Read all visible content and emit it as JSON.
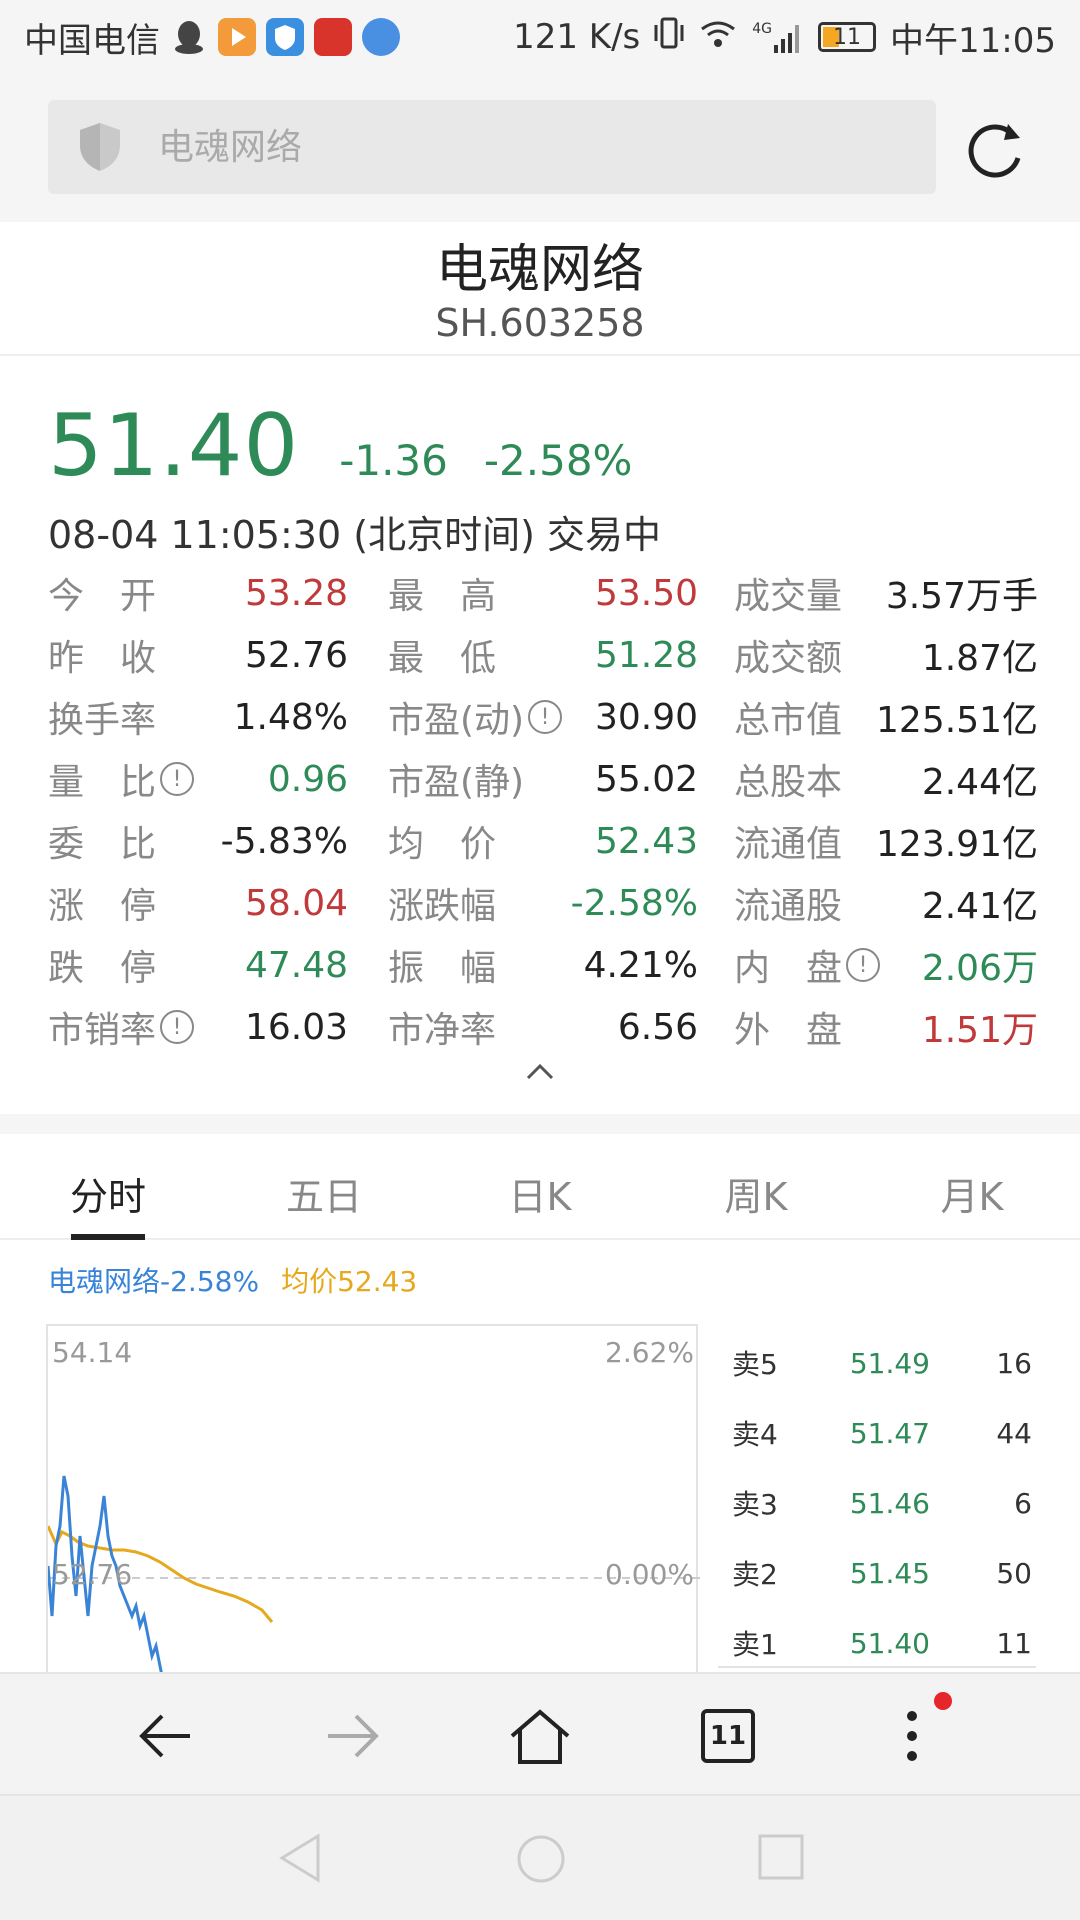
{
  "status_bar": {
    "carrier": "中国电信",
    "net_speed": "121 K/s",
    "network": "4G",
    "battery": "11",
    "time": "中午11:05"
  },
  "search": {
    "placeholder": "电魂网络"
  },
  "stock": {
    "name": "电魂网络",
    "code": "SH.603258",
    "price": "51.40",
    "change": "-1.36",
    "change_pct": "-2.58%",
    "time_status": "08-04 11:05:30 (北京时间) 交易中"
  },
  "stats": [
    [
      {
        "label": "今　开",
        "value": "53.28",
        "color": "red"
      },
      {
        "label": "最　高",
        "value": "53.50",
        "color": "red"
      },
      {
        "label": "成交量",
        "value": "3.57万手",
        "color": ""
      }
    ],
    [
      {
        "label": "昨　收",
        "value": "52.76",
        "color": ""
      },
      {
        "label": "最　低",
        "value": "51.28",
        "color": "green"
      },
      {
        "label": "成交额",
        "value": "1.87亿",
        "color": ""
      }
    ],
    [
      {
        "label": "换手率",
        "value": "1.48%",
        "color": ""
      },
      {
        "label": "市盈(动)",
        "value": "30.90",
        "color": "",
        "info": true
      },
      {
        "label": "总市值",
        "value": "125.51亿",
        "color": ""
      }
    ],
    [
      {
        "label": "量　比",
        "value": "0.96",
        "color": "green",
        "info": true
      },
      {
        "label": "市盈(静)",
        "value": "55.02",
        "color": ""
      },
      {
        "label": "总股本",
        "value": "2.44亿",
        "color": ""
      }
    ],
    [
      {
        "label": "委　比",
        "value": "-5.83%",
        "color": ""
      },
      {
        "label": "均　价",
        "value": "52.43",
        "color": "green"
      },
      {
        "label": "流通值",
        "value": "123.91亿",
        "color": ""
      }
    ],
    [
      {
        "label": "涨　停",
        "value": "58.04",
        "color": "red"
      },
      {
        "label": "涨跌幅",
        "value": "-2.58%",
        "color": "green"
      },
      {
        "label": "流通股",
        "value": "2.41亿",
        "color": ""
      }
    ],
    [
      {
        "label": "跌　停",
        "value": "47.48",
        "color": "green"
      },
      {
        "label": "振　幅",
        "value": "4.21%",
        "color": ""
      },
      {
        "label": "内　盘",
        "value": "2.06万",
        "color": "green",
        "info": true
      }
    ],
    [
      {
        "label": "市销率",
        "value": "16.03",
        "color": "",
        "info": true
      },
      {
        "label": "市净率",
        "value": "6.56",
        "color": ""
      },
      {
        "label": "外　盘",
        "value": "1.51万",
        "color": "red"
      }
    ]
  ],
  "tabs": [
    "分时",
    "五日",
    "日K",
    "周K",
    "月K"
  ],
  "chart_legend": {
    "price": "电魂网络-2.58%",
    "avg": "均价52.43"
  },
  "chart_axis": {
    "top_price": "54.14",
    "top_pct": "2.62%",
    "mid_price": "52.76",
    "mid_pct": "0.00%"
  },
  "order_book": [
    {
      "label": "卖5",
      "price": "51.49",
      "vol": "16"
    },
    {
      "label": "卖4",
      "price": "51.47",
      "vol": "44"
    },
    {
      "label": "卖3",
      "price": "51.46",
      "vol": "6"
    },
    {
      "label": "卖2",
      "price": "51.45",
      "vol": "50"
    },
    {
      "label": "卖1",
      "price": "51.40",
      "vol": "11"
    }
  ],
  "browser_nav": {
    "tab_count": "11"
  },
  "colors": {
    "up": "#c0393b",
    "down": "#2e8b57",
    "price_line": "#3a84d8",
    "avg_line": "#e6a81c"
  }
}
